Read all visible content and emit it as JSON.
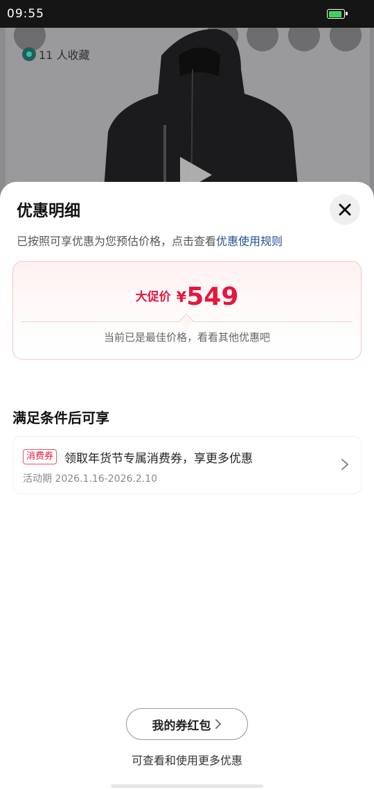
{
  "status_bar": {
    "time": "09:55",
    "battery_color": "#3fd25a"
  },
  "product": {
    "favorites_label": "11 人收藏"
  },
  "sheet": {
    "title": "优惠明细",
    "subtitle_prefix": "已按照可享优惠为您预估价格，点击查看",
    "subtitle_link": "优惠使用规则",
    "price_card": {
      "label": "大促价",
      "currency": "¥",
      "value": "549",
      "note": "当前已是最佳价格，看看其他优惠吧"
    },
    "conditions_section": {
      "title": "满足条件后可享",
      "coupon": {
        "badge": "消费券",
        "text": "领取年货节专属消费券，享更多优惠",
        "date": "活动期 2026.1.16-2026.2.10"
      }
    },
    "wallet_button_label": "我的券红包",
    "wallet_note": "可查看和使用更多优惠"
  },
  "colors": {
    "accent": "#e5173d",
    "link": "#1f4f8f"
  }
}
